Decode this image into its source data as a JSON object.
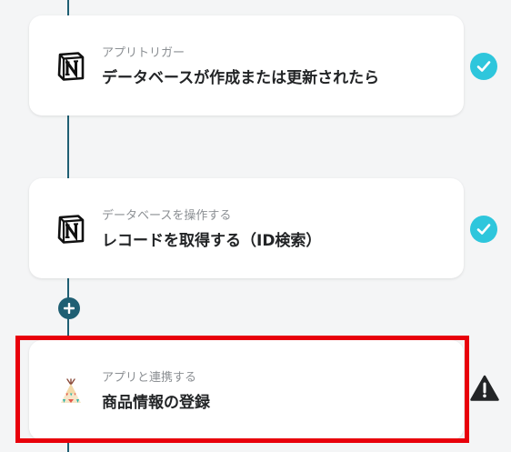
{
  "flow": {
    "steps": [
      {
        "subtitle": "アプリトリガー",
        "title": "データベースが作成または更新されたら",
        "app_icon": "notion-icon",
        "status": "complete",
        "status_icon": "check-icon"
      },
      {
        "subtitle": "データベースを操作する",
        "title": "レコードを取得する（ID検索）",
        "app_icon": "notion-icon",
        "status": "complete",
        "status_icon": "check-icon"
      },
      {
        "subtitle": "アプリと連携する",
        "title": "商品情報の登録",
        "app_icon": "tent-app-icon",
        "status": "warning",
        "status_icon": "warning-icon",
        "highlighted": true
      }
    ],
    "add_step_icon": "plus-icon"
  },
  "colors": {
    "connector": "#1f5f73",
    "check_badge": "#2ec6dc",
    "highlight_frame": "#e8000b",
    "warning": "#222426"
  }
}
